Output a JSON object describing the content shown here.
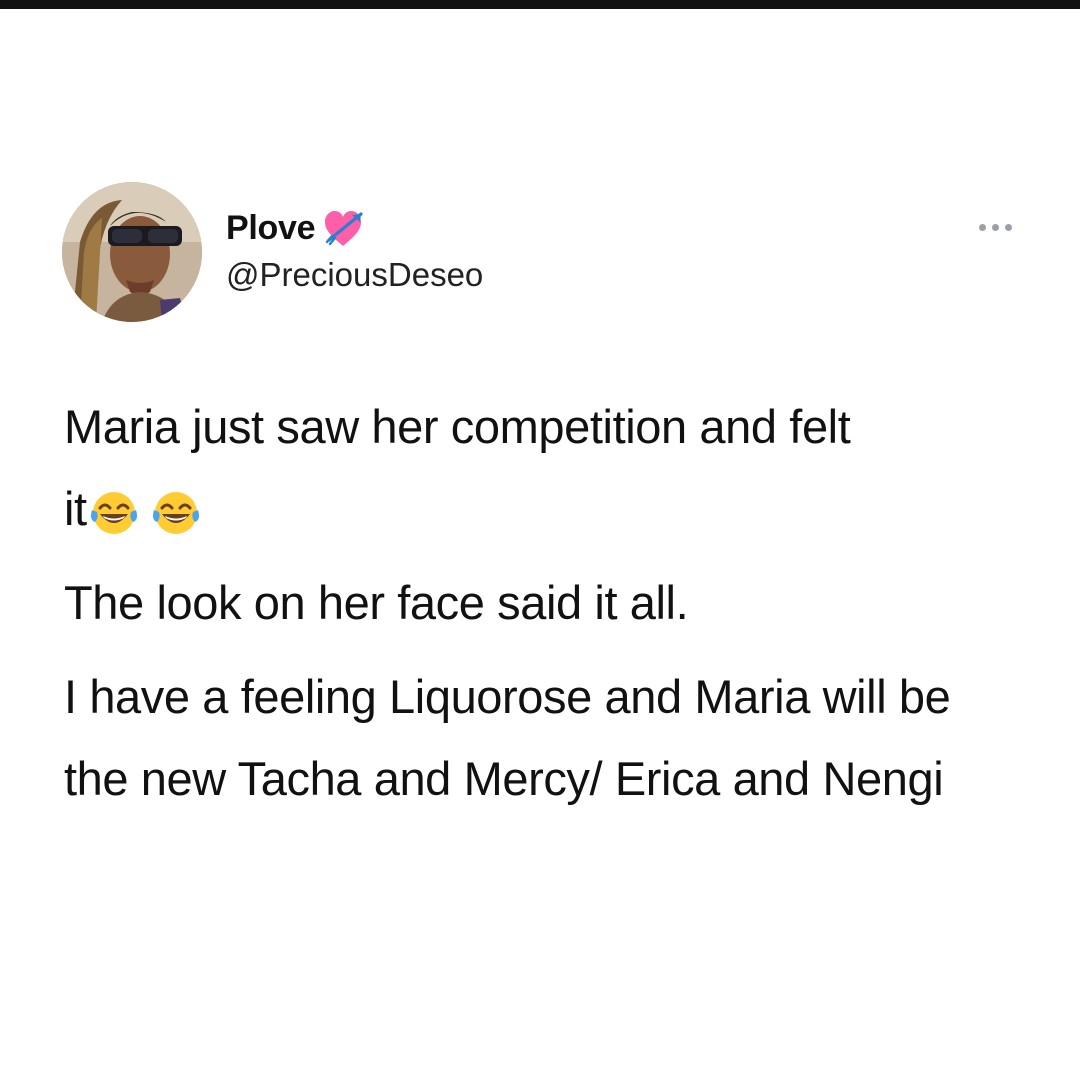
{
  "tweet": {
    "display_name": "Plove",
    "handle": "@PreciousDeseo",
    "name_badge_icon": "heart-with-arrow-icon",
    "more_icon": "more-options-dots-icon",
    "text": {
      "line1": "Maria just saw her competition and felt",
      "line2_prefix": "it",
      "line2_emojis": [
        "face-with-tears-of-joy-icon",
        "face-with-tears-of-joy-icon"
      ],
      "para2": "The look on her face said it all.",
      "para3": "I have a feeling Liquorose and Maria will be the new Tacha and Mercy/ Erica and Nengi"
    }
  },
  "colors": {
    "text": "#111111",
    "handle": "#222222",
    "more_dots": "#9aa0a6",
    "top_bar": "#111111",
    "background": "#ffffff",
    "heart": "#ff5ea8"
  }
}
